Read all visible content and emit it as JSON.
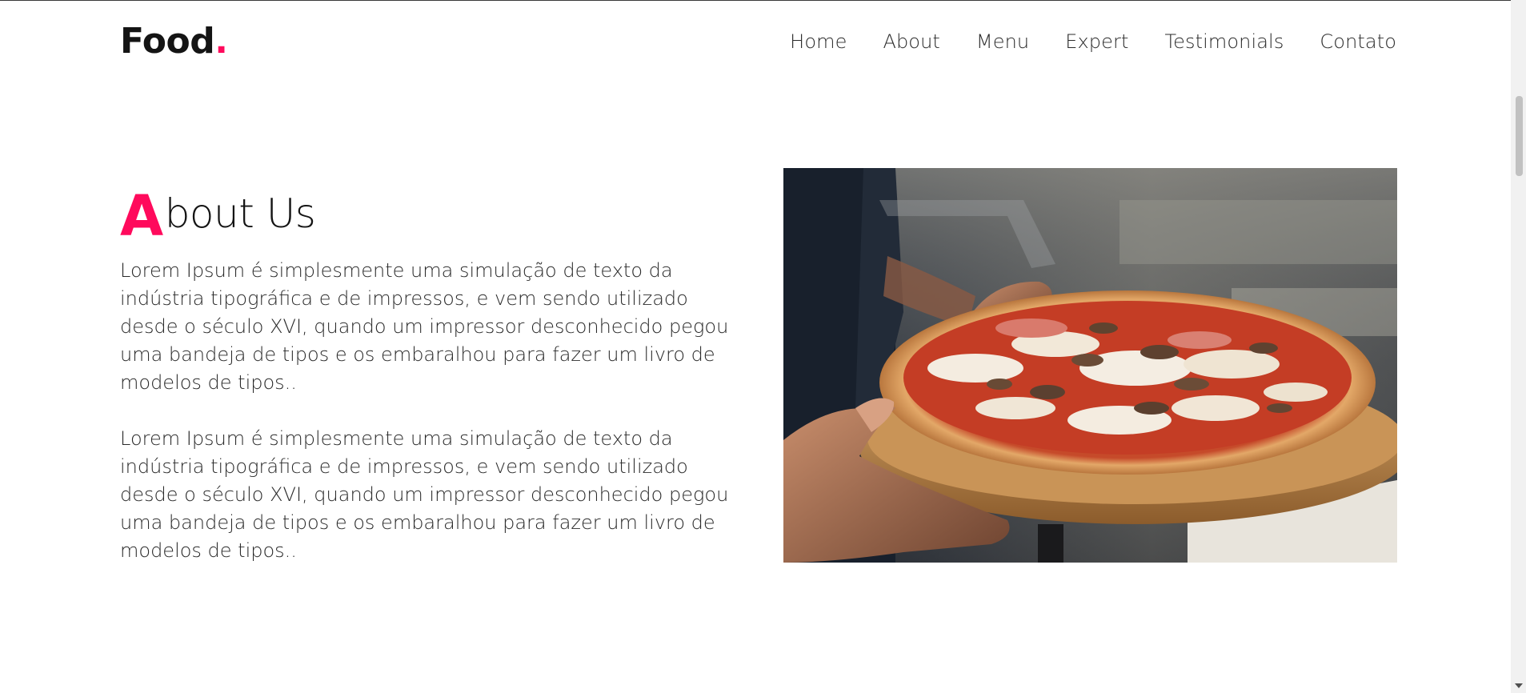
{
  "logo": {
    "text": "Food",
    "dot": "."
  },
  "nav": {
    "items": [
      {
        "id": "home",
        "label": "Home"
      },
      {
        "id": "about",
        "label": "About"
      },
      {
        "id": "menu",
        "label": "Menu"
      },
      {
        "id": "expert",
        "label": "Expert"
      },
      {
        "id": "testimonials",
        "label": "Testimonials"
      },
      {
        "id": "contato",
        "label": "Contato"
      }
    ]
  },
  "about": {
    "title_initial": "A",
    "title_rest": "bout Us",
    "paragraphs": [
      "Lorem Ipsum é simplesmente uma simulação de texto da indústria tipográfica e de impressos, e vem sendo utilizado desde o século XVI, quando um impressor desconhecido pegou uma bandeja de tipos e os embaralhou para fazer um livro de modelos de tipos..",
      "Lorem Ipsum é simplesmente uma simulação de texto da indústria tipográfica e de impressos, e vem sendo utilizado desde o século XVI, quando um impressor desconhecido pegou uma bandeja de tipos e os embaralhou para fazer um livro de modelos de tipos.."
    ]
  },
  "colors": {
    "accent": "#ff0a5c",
    "text": "#1b1b1b",
    "background": "#ffffff"
  }
}
